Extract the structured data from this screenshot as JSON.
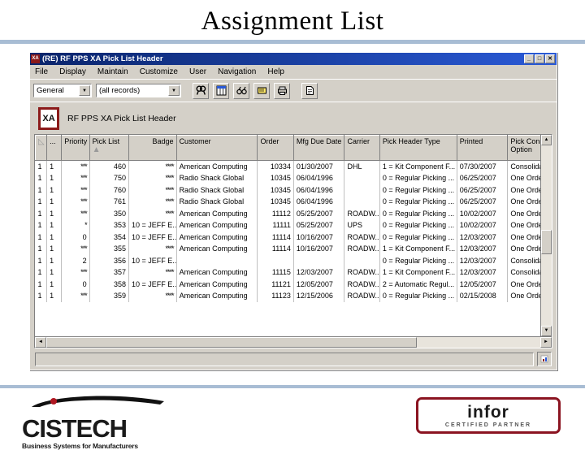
{
  "slide": {
    "title": "Assignment List",
    "rule_color": "#a8bdd4"
  },
  "window": {
    "title": "(RE) RF PPS XA Pick List Header",
    "icon_label": "XA",
    "buttons": {
      "minimize": "_",
      "maximize": "□",
      "close": "✕"
    },
    "menu": [
      {
        "label": "File"
      },
      {
        "label": "Display"
      },
      {
        "label": "Maintain"
      },
      {
        "label": "Customize"
      },
      {
        "label": "User"
      },
      {
        "label": "Navigation"
      },
      {
        "label": "Help"
      }
    ],
    "toolbar": {
      "view_select": {
        "value": "General",
        "arrow": "▼"
      },
      "filter_select": {
        "value": "(all records)",
        "arrow": "▼"
      },
      "buttons": [
        {
          "name": "find-icon",
          "glyph": "🔍"
        },
        {
          "name": "grid-view-icon",
          "glyph": "▤"
        },
        {
          "name": "glasses-icon",
          "glyph": "6∂"
        },
        {
          "name": "note-icon",
          "glyph": "▭"
        },
        {
          "name": "print-icon",
          "glyph": "🖶"
        },
        {
          "name": "document-icon",
          "glyph": "🗎"
        }
      ]
    },
    "banner": {
      "logo": "XA",
      "text": "RF PPS XA Pick List Header"
    },
    "statusbar": {
      "message": "",
      "icon": "▯"
    }
  },
  "grid": {
    "columns": [
      {
        "key": "sel",
        "label": "",
        "class": "c-sel",
        "sortmark": "◺"
      },
      {
        "key": "dots",
        "label": "...",
        "class": "c-dots"
      },
      {
        "key": "prio",
        "label": "Priority",
        "class": "c-prio"
      },
      {
        "key": "pick",
        "label": "Pick List",
        "class": "c-pick",
        "sortmark": "▲"
      },
      {
        "key": "badge",
        "label": "Badge",
        "class": "c-badge",
        "align": "right"
      },
      {
        "key": "cust",
        "label": "Customer",
        "class": "c-cust"
      },
      {
        "key": "order",
        "label": "Order",
        "class": "c-order"
      },
      {
        "key": "mfg",
        "label": "Mfg Due Date",
        "class": "c-mfg"
      },
      {
        "key": "carr",
        "label": "Carrier",
        "class": "c-carr"
      },
      {
        "key": "type",
        "label": "Pick Header Type",
        "class": "c-type"
      },
      {
        "key": "print",
        "label": "Printed",
        "class": "c-print"
      },
      {
        "key": "cons",
        "label": "Pick Consol Option",
        "class": "c-cons"
      }
    ],
    "rows": [
      {
        "sel": "1",
        "dots": "1",
        "prio": "***",
        "pick": "460",
        "badge": "****",
        "cust": "American Computing",
        "order": "10334",
        "mfg": "01/30/2007",
        "carr": "DHL",
        "type": "1 = Kit Component F...",
        "print": "07/30/2007",
        "cons": "Consolidated"
      },
      {
        "sel": "1",
        "dots": "1",
        "prio": "***",
        "pick": "750",
        "badge": "****",
        "cust": "Radio Shack Global",
        "order": "10345",
        "mfg": "06/04/1996",
        "carr": "",
        "type": "0 = Regular Picking ...",
        "print": "06/25/2007",
        "cons": "One Order, C..."
      },
      {
        "sel": "1",
        "dots": "1",
        "prio": "***",
        "pick": "760",
        "badge": "****",
        "cust": "Radio Shack Global",
        "order": "10345",
        "mfg": "06/04/1996",
        "carr": "",
        "type": "0 = Regular Picking ...",
        "print": "06/25/2007",
        "cons": "One Order, C..."
      },
      {
        "sel": "1",
        "dots": "1",
        "prio": "***",
        "pick": "761",
        "badge": "****",
        "cust": "Radio Shack Global",
        "order": "10345",
        "mfg": "06/04/1996",
        "carr": "",
        "type": "0 = Regular Picking ...",
        "print": "06/25/2007",
        "cons": "One Order, C..."
      },
      {
        "sel": "1",
        "dots": "1",
        "prio": "***",
        "pick": "350",
        "badge": "****",
        "cust": "American Computing",
        "order": "11112",
        "mfg": "05/25/2007",
        "carr": "ROADW..",
        "type": "0 = Regular Picking ...",
        "print": "10/02/2007",
        "cons": "One Order, C..."
      },
      {
        "sel": "1",
        "dots": "1",
        "prio": "*",
        "pick": "353",
        "badge": "10 = JEFF E...",
        "cust": "American Computing",
        "order": "11111",
        "mfg": "05/25/2007",
        "carr": "UPS",
        "type": "0 = Regular Picking ...",
        "print": "10/02/2007",
        "cons": "One Order, C..."
      },
      {
        "sel": "1",
        "dots": "1",
        "prio": "0",
        "pick": "354",
        "badge": "10 = JEFF E...",
        "cust": "American Computing",
        "order": "11114",
        "mfg": "10/16/2007",
        "carr": "ROADW..",
        "type": "0 = Regular Picking ...",
        "print": "12/03/2007",
        "cons": "One Order, C..."
      },
      {
        "sel": "1",
        "dots": "1",
        "prio": "***",
        "pick": "355",
        "badge": "****",
        "cust": "American Computing",
        "order": "11114",
        "mfg": "10/16/2007",
        "carr": "ROADW..",
        "type": "1 = Kit Component F...",
        "print": "12/03/2007",
        "cons": "One Order, C..."
      },
      {
        "sel": "1",
        "dots": "1",
        "prio": "2",
        "pick": "356",
        "badge": "10 = JEFF E...",
        "cust": "",
        "order": "",
        "mfg": "",
        "carr": "",
        "type": "0 = Regular Picking ...",
        "print": "12/03/2007",
        "cons": "Consolidated"
      },
      {
        "sel": "1",
        "dots": "1",
        "prio": "***",
        "pick": "357",
        "badge": "****",
        "cust": "American Computing",
        "order": "11115",
        "mfg": "12/03/2007",
        "carr": "ROADW..",
        "type": "1 = Kit Component F...",
        "print": "12/03/2007",
        "cons": "Consolidated"
      },
      {
        "sel": "1",
        "dots": "1",
        "prio": "0",
        "pick": "358",
        "badge": "10 = JEFF E...",
        "cust": "American Computing",
        "order": "11121",
        "mfg": "12/05/2007",
        "carr": "ROADW..",
        "type": "2 = Automatic Regul...",
        "print": "12/05/2007",
        "cons": "One Order, C..."
      },
      {
        "sel": "1",
        "dots": "1",
        "prio": "***",
        "pick": "359",
        "badge": "****",
        "cust": "American Computing",
        "order": "11123",
        "mfg": "12/15/2006",
        "carr": "ROADW..",
        "type": "0 = Regular Picking ...",
        "print": "02/15/2008",
        "cons": "One Order, C..."
      }
    ],
    "scroll": {
      "up": "▲",
      "down": "▼",
      "left": "◄",
      "right": "►"
    }
  },
  "logos": {
    "cistech": {
      "name": "CISTECH",
      "tagline": "Business Systems for Manufacturers"
    },
    "infor": {
      "name": "infor",
      "tagline": "CERTIFIED PARTNER",
      "border_color": "#8b1421"
    }
  }
}
